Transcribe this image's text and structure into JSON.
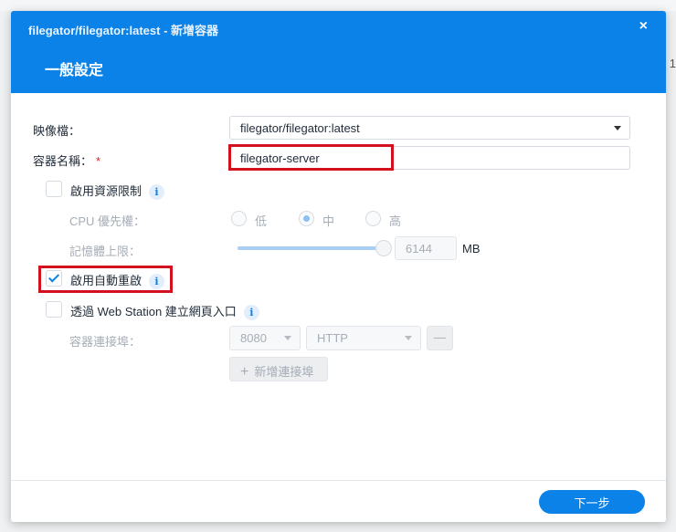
{
  "background": {
    "edge_text": "1"
  },
  "dialog": {
    "title": "filegator/filegator:latest - 新增容器",
    "close_icon": "×",
    "section_title": "一般設定",
    "image": {
      "label": "映像檔：",
      "value": "filegator/filegator:latest"
    },
    "container_name": {
      "label": "容器名稱：",
      "required": "*",
      "value": "filegator-server"
    },
    "resource_limit": {
      "label": "啟用資源限制",
      "checked": false,
      "info": "i"
    },
    "cpu_priority": {
      "label": "CPU 優先權：",
      "options": [
        "低",
        "中",
        "高"
      ],
      "selected": "中"
    },
    "memory_limit": {
      "label": "記憶體上限：",
      "value": "6144",
      "unit": "MB",
      "slider_fraction": 1.0
    },
    "auto_restart": {
      "label": "啟用自動重啟",
      "checked": true,
      "info": "i"
    },
    "web_station": {
      "label": "透過 Web Station 建立網頁入口",
      "checked": false,
      "info": "i"
    },
    "container_port": {
      "label": "容器連接埠：",
      "port": "8080",
      "protocol": "HTTP",
      "remove": "—",
      "add_label": "新增連接埠",
      "add_icon": "+"
    },
    "next_button": "下一步"
  }
}
